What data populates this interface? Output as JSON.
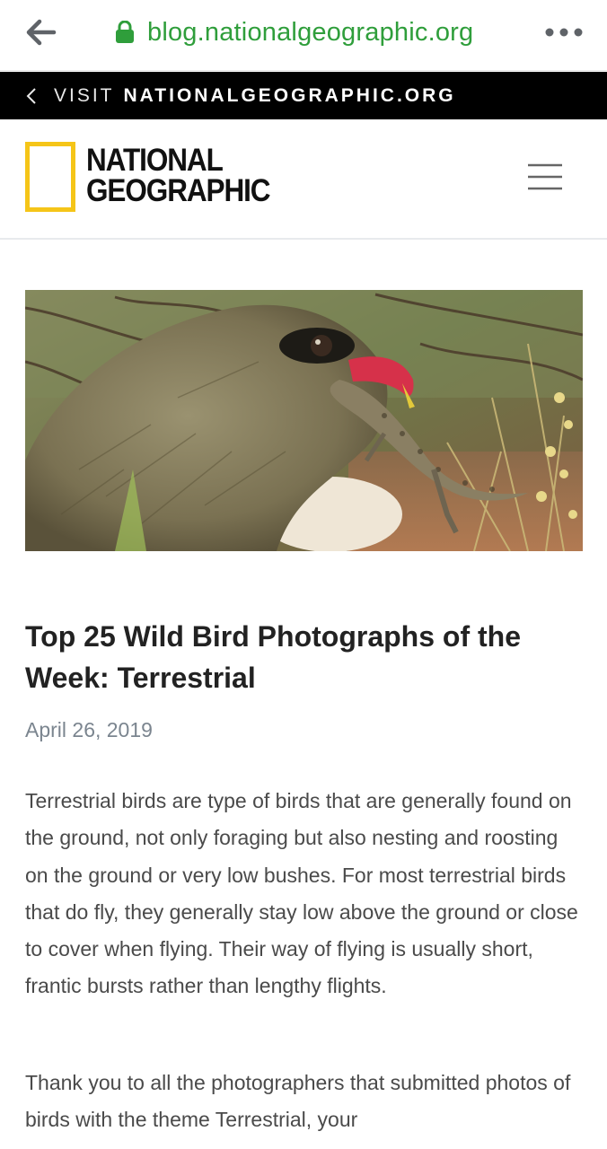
{
  "browser": {
    "url": "blog.nationalgeographic.org"
  },
  "visit_strip": {
    "prefix": "VISIT",
    "site": "NATIONALGEOGRAPHIC.ORG"
  },
  "logo": {
    "line1": "NATIONAL",
    "line2": "GEOGRAPHIC",
    "accent_color": "#f5c518"
  },
  "article": {
    "title": "Top 25 Wild Bird Photographs of the Week: Terrestrial",
    "date": "April 26, 2019",
    "paragraphs": [
      "Terrestrial birds are type of birds that are generally found on the ground, not only foraging but also nesting and roosting on the ground or very low bushes. For most terrestrial birds that do fly, they generally stay low above the ground or close to cover when flying. Their way of flying is usually short, frantic bursts rather than lengthy flights.",
      "Thank you to all the photographers that submitted photos of birds with the theme Terrestrial, your"
    ]
  },
  "colors": {
    "url_green": "#2f9e3b",
    "strip_black": "#000000",
    "date_gray": "#7b858f"
  }
}
